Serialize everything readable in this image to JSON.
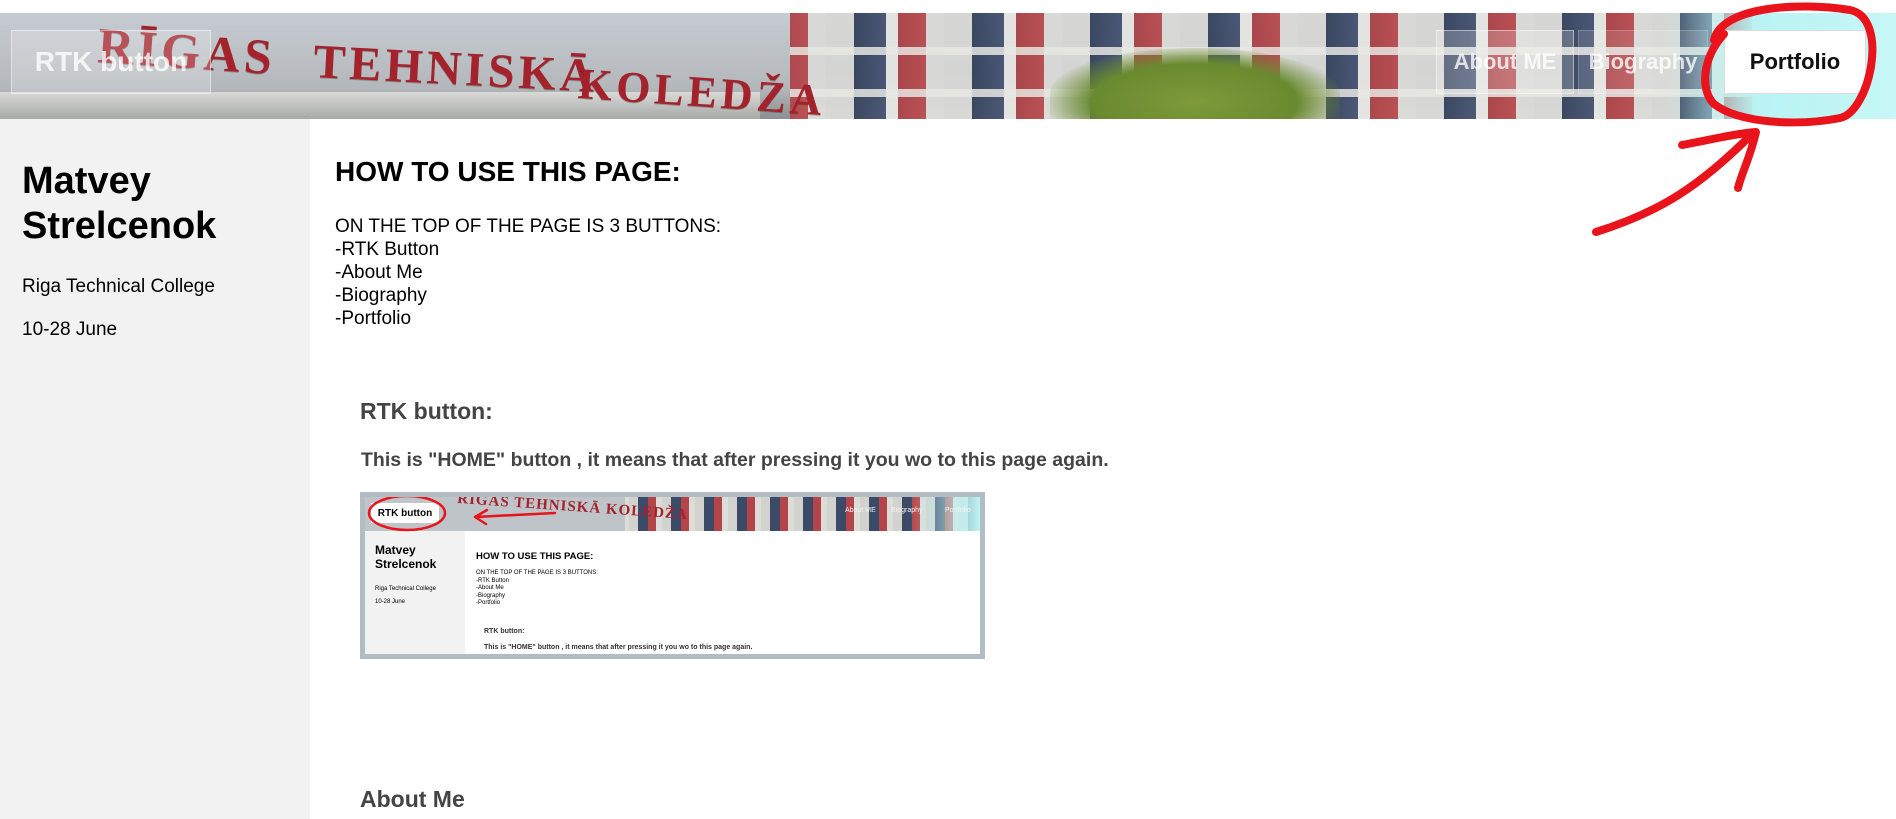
{
  "header": {
    "sign": [
      "RĪGAS",
      "TEHNISKĀ",
      "KOLEDŽA"
    ],
    "nav": {
      "rtk_label": "RTK button",
      "about_label": "About ME",
      "biography_label": "Biography",
      "portfolio_label": "Portfolio"
    }
  },
  "sidebar": {
    "name": "Matvey Strelcenok",
    "school": "Riga Technical College",
    "dates": "10-28 June"
  },
  "main": {
    "title": "HOW TO USE THIS PAGE:",
    "intro_lines": [
      "ON THE TOP OF THE PAGE IS 3 BUTTONS:",
      "-RTK Button",
      "-About Me",
      "-Biography",
      "-Portfolio"
    ],
    "rtk_section": {
      "heading": "RTK button:",
      "description": "This is \"HOME\" button , it means that after pressing it you wo to this page again."
    },
    "about_section": {
      "heading": "About Me"
    }
  },
  "screenshot_preview": {
    "sign": "RĪGAS TEHNISKĀ KOLEDŽA",
    "rtk_label": "RTK button",
    "about_label": "About ME",
    "biography_label": "Biography",
    "portfolio_label": "Portfolio",
    "name": "Matvey Strelcenok",
    "school": "Riga Technical College",
    "dates": "10-28 June",
    "title": "HOW TO USE THIS PAGE:",
    "intro_lines": [
      "ON THE TOP OF THE PAGE IS 3 BUTTONS:",
      "-RTK Button",
      "-About Me",
      "-Biography",
      "-Portfolio"
    ],
    "section_heading": "RTK button:",
    "description": "This is \"HOME\" button , it means that after pressing it you wo to this page again."
  },
  "colors": {
    "sign_red": "#a3222c",
    "annotation_red": "#e8131b",
    "sidebar_bg": "#f2f2f2",
    "section_text": "#444444",
    "preview_border": "#b2bcc4"
  }
}
